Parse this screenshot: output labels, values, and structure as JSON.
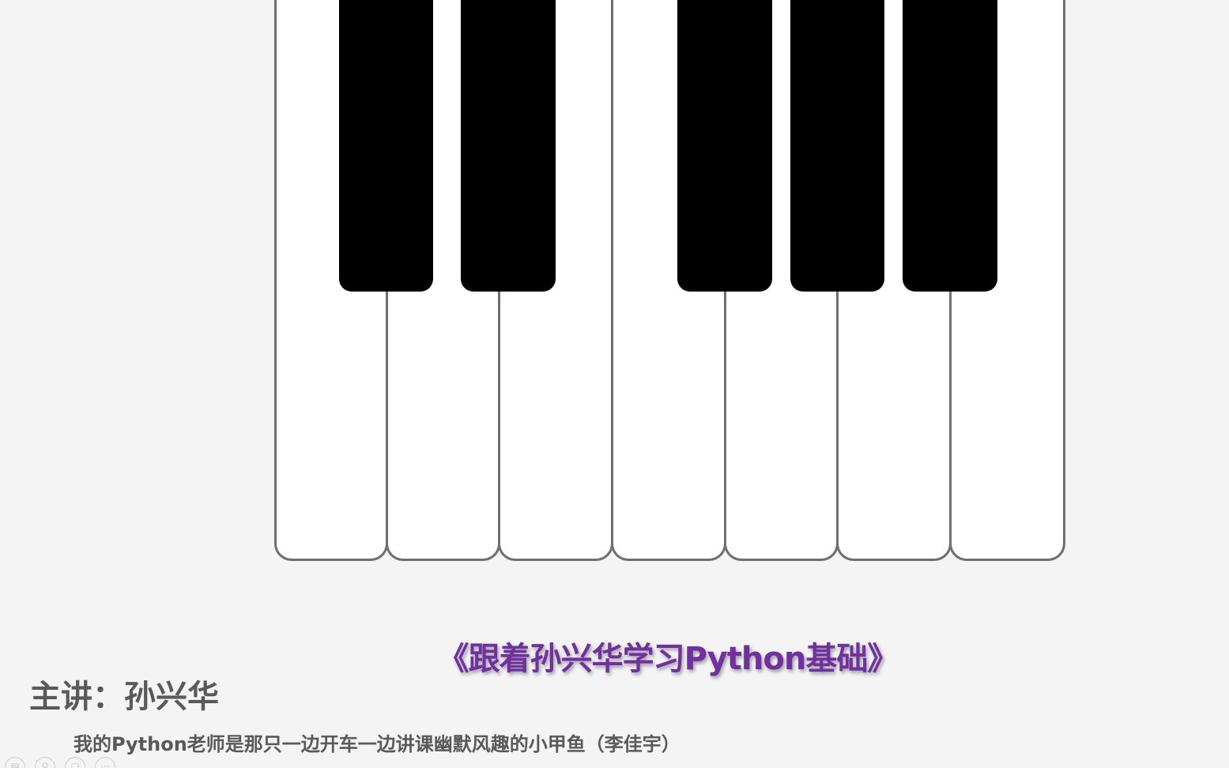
{
  "slide": {
    "course_title": "《跟着孙兴华学习Python基础》",
    "lecturer": "主讲：孙兴华",
    "subtitle": "我的Python老师是那只一边开车一边讲课幽默风趣的小甲鱼（李佳宇）"
  },
  "colors": {
    "background": "#f4f4f4",
    "white_key": "#ffffff",
    "key_border": "#6f6f6f",
    "black_key": "#000000",
    "title_purple": "#7030a0",
    "text_gray": "#595959"
  },
  "keyboard": {
    "white_keys": 7,
    "black_keys": 5
  },
  "controls": [
    {
      "name": "menu-control-icon",
      "glyph": "▤"
    },
    {
      "name": "zoom-control-icon",
      "glyph": "⚲"
    },
    {
      "name": "slide-control-icon",
      "glyph": "▢"
    },
    {
      "name": "more-control-icon",
      "glyph": "⋯"
    }
  ]
}
